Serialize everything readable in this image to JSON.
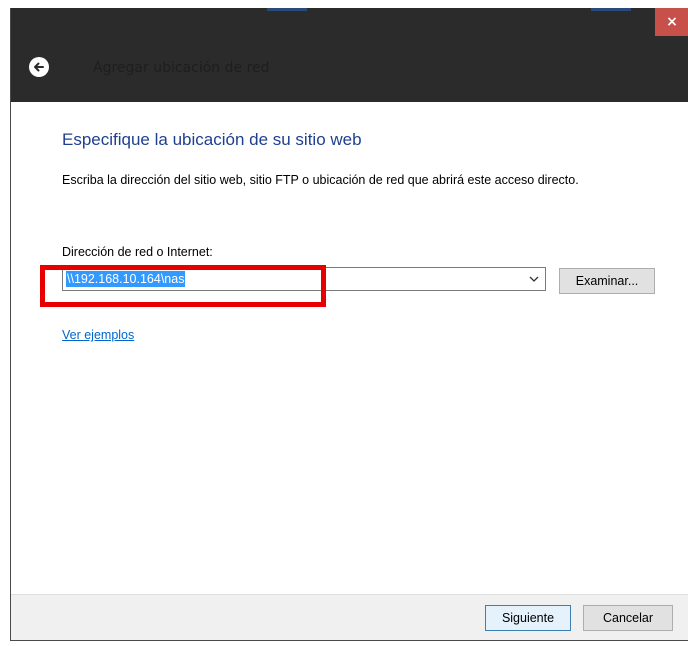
{
  "window": {
    "title": "Agregar ubicación de red",
    "close_symbol": "×"
  },
  "icons": {
    "back": "back-arrow-icon",
    "dropdown": "chevron-down-icon",
    "close": "close-icon"
  },
  "page": {
    "heading": "Especifique la ubicación de su sitio web",
    "description": "Escriba la dirección del sitio web, sitio FTP o ubicación de red que abrirá este acceso directo.",
    "field_label": "Dirección de red o Internet:",
    "address_value": "\\\\192.168.10.164\\nas",
    "browse_label": "Examinar...",
    "examples_link": "Ver ejemplos"
  },
  "footer": {
    "next_label": "Siguiente",
    "cancel_label": "Cancelar"
  },
  "colors": {
    "heading": "#1f3f8f",
    "selection": "#3399ff",
    "annotation": "#e80000",
    "close": "#c7504a",
    "link": "#0066cc"
  }
}
